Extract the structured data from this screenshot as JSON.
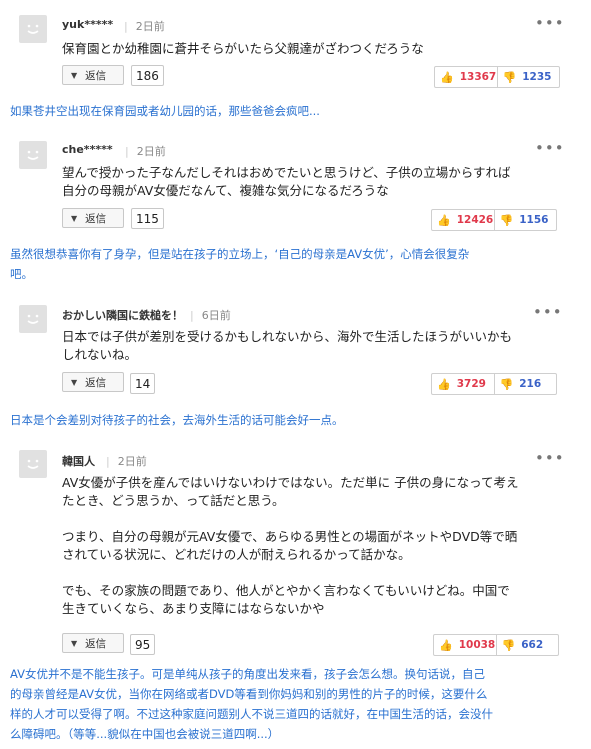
{
  "reply_label": "返信",
  "more_glyph": "•••",
  "colors": {
    "translation": "#2a71d0",
    "upvote": "#e0394b",
    "downvote": "#3a62c7"
  },
  "comments": [
    {
      "user": "yuk*****",
      "time": "2日前",
      "text": "保育園とか幼稚園に蒼井そらがいたら父親達がざわつくだろうな",
      "replies": "186",
      "up": "13367",
      "down": "1235",
      "translation": "如果苍井空出现在保育园或者幼儿园的话，那些爸爸会疯吧..."
    },
    {
      "user": "che*****",
      "time": "2日前",
      "text": "望んで授かった子なんだしそれはおめでたいと思うけど、子供の立場からすれば\n自分の母親がAV女優だなんて、複雑な気分になるだろうな",
      "replies": "115",
      "up": "12426",
      "down": "1156",
      "translation": "虽然很想恭喜你有了身孕，但是站在孩子的立场上，‘自己的母亲是AV女优’，心情会很复杂\n吧。"
    },
    {
      "user": "おかしい隣国に鉄槌を！",
      "time": "6日前",
      "text": "日本では子供が差別を受けるかもしれないから、海外で生活したほうがいいかも\nしれないね。",
      "replies": "14",
      "up": "3729",
      "down": "216",
      "translation": "日本是个会差别对待孩子的社会，去海外生活的话可能会好一点。"
    },
    {
      "user": "韓国人",
      "time": "2日前",
      "text": "AV女優が子供を産んではいけないわけではない。ただ単に 子供の身になって考え\nたとき、どう思うか、って話だと思う。\n\nつまり、自分の母親が元AV女優で、あらゆる男性との場面がネットやDVD等で晒\nされている状況に、どれだけの人が耐えられるかって話かな。\n\nでも、その家族の問題であり、他人がとやかく言わなくてもいいけどね。中国で\n生きていくなら、あまり支障にはならないかや",
      "replies": "95",
      "up": "10038",
      "down": "662",
      "translation": "AV女优并不是不能生孩子。可是单纯从孩子的角度出发来看，孩子会怎么想。换句话说，自己\n的母亲曾经是AV女优，当你在网络或者DVD等看到你妈妈和别的男性的片子的时候，这要什么\n样的人才可以受得了啊。不过这种家庭问题别人不说三道四的话就好，在中国生活的话，会没什\n么障碍吧。（等等...貌似在中国也会被说三道四啊...）"
    }
  ]
}
